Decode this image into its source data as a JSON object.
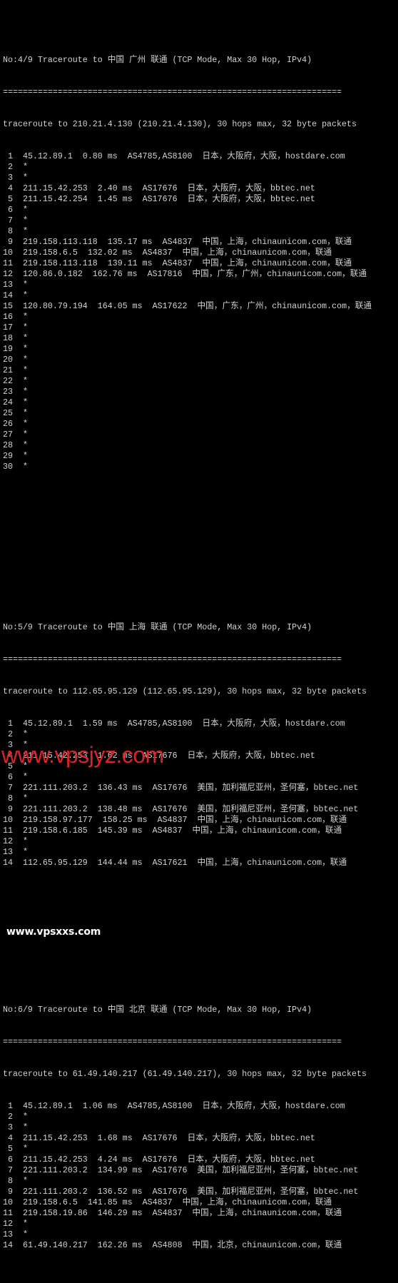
{
  "watermarks": {
    "top": "www.vpsxxs.com",
    "bottom": "www.vpsjyz.com",
    "bottom_color": "#e3262b"
  },
  "sections": [
    {
      "header": "No:4/9 Traceroute to 中国 广州 联通 (TCP Mode, Max 30 Hop, IPv4)",
      "separator": "====================================================================",
      "summary": "traceroute to 210.21.4.130 (210.21.4.130), 30 hops max, 32 byte packets",
      "hops": [
        {
          "n": "1",
          "ip": "45.12.89.1",
          "rtt": "0.80 ms",
          "asn": "AS4785,AS8100",
          "geo": "日本，大阪府，大阪，hostdare.com"
        },
        {
          "n": "2",
          "star": "*"
        },
        {
          "n": "3",
          "star": "*"
        },
        {
          "n": "4",
          "ip": "211.15.42.253",
          "rtt": "2.40 ms",
          "asn": "AS17676",
          "geo": "日本，大阪府，大阪，bbtec.net"
        },
        {
          "n": "5",
          "ip": "211.15.42.254",
          "rtt": "1.45 ms",
          "asn": "AS17676",
          "geo": "日本，大阪府，大阪，bbtec.net"
        },
        {
          "n": "6",
          "star": "*"
        },
        {
          "n": "7",
          "star": "*"
        },
        {
          "n": "8",
          "star": "*"
        },
        {
          "n": "9",
          "ip": "219.158.113.118",
          "rtt": "135.17 ms",
          "asn": "AS4837",
          "geo": "中国，上海，chinaunicom.com，联通"
        },
        {
          "n": "10",
          "ip": "219.158.6.5",
          "rtt": "132.02 ms",
          "asn": "AS4837",
          "geo": "中国，上海，chinaunicom.com，联通"
        },
        {
          "n": "11",
          "ip": "219.158.113.118",
          "rtt": "139.11 ms",
          "asn": "AS4837",
          "geo": "中国，上海，chinaunicom.com，联通"
        },
        {
          "n": "12",
          "ip": "120.86.0.182",
          "rtt": "162.76 ms",
          "asn": "AS17816",
          "geo": "中国，广东，广州，chinaunicom.com，联通"
        },
        {
          "n": "13",
          "star": "*"
        },
        {
          "n": "14",
          "star": "*"
        },
        {
          "n": "15",
          "ip": "120.80.79.194",
          "rtt": "164.05 ms",
          "asn": "AS17622",
          "geo": "中国，广东，广州，chinaunicom.com，联通"
        },
        {
          "n": "16",
          "star": "*"
        },
        {
          "n": "17",
          "star": "*"
        },
        {
          "n": "18",
          "star": "*"
        },
        {
          "n": "19",
          "star": "*"
        },
        {
          "n": "20",
          "star": "*"
        },
        {
          "n": "21",
          "star": "*"
        },
        {
          "n": "22",
          "star": "*"
        },
        {
          "n": "23",
          "star": "*"
        },
        {
          "n": "24",
          "star": "*"
        },
        {
          "n": "25",
          "star": "*"
        },
        {
          "n": "26",
          "star": "*"
        },
        {
          "n": "27",
          "star": "*"
        },
        {
          "n": "28",
          "star": "*"
        },
        {
          "n": "29",
          "star": "*"
        },
        {
          "n": "30",
          "star": "*"
        }
      ]
    },
    {
      "header": "No:5/9 Traceroute to 中国 上海 联通 (TCP Mode, Max 30 Hop, IPv4)",
      "separator": "====================================================================",
      "summary": "traceroute to 112.65.95.129 (112.65.95.129), 30 hops max, 32 byte packets",
      "hops": [
        {
          "n": "1",
          "ip": "45.12.89.1",
          "rtt": "1.59 ms",
          "asn": "AS4785,AS8100",
          "geo": "日本，大阪府，大阪，hostdare.com"
        },
        {
          "n": "2",
          "star": "*"
        },
        {
          "n": "3",
          "star": "*"
        },
        {
          "n": "4",
          "ip": "211.15.42.253",
          "rtt": "1.62 ms",
          "asn": "AS17676",
          "geo": "日本，大阪府，大阪，bbtec.net"
        },
        {
          "n": "5",
          "star": "*"
        },
        {
          "n": "6",
          "star": "*"
        },
        {
          "n": "7",
          "ip": "221.111.203.2",
          "rtt": "136.43 ms",
          "asn": "AS17676",
          "geo": "美国，加利福尼亚州，圣何塞，bbtec.net"
        },
        {
          "n": "8",
          "star": "*"
        },
        {
          "n": "9",
          "ip": "221.111.203.2",
          "rtt": "138.48 ms",
          "asn": "AS17676",
          "geo": "美国，加利福尼亚州，圣何塞，bbtec.net"
        },
        {
          "n": "10",
          "ip": "219.158.97.177",
          "rtt": "158.25 ms",
          "asn": "AS4837",
          "geo": "中国，上海，chinaunicom.com，联通"
        },
        {
          "n": "11",
          "ip": "219.158.6.185",
          "rtt": "145.39 ms",
          "asn": "AS4837",
          "geo": "中国，上海，chinaunicom.com，联通"
        },
        {
          "n": "12",
          "star": "*"
        },
        {
          "n": "13",
          "star": "*"
        },
        {
          "n": "14",
          "ip": "112.65.95.129",
          "rtt": "144.44 ms",
          "asn": "AS17621",
          "geo": "中国，上海，chinaunicom.com，联通"
        }
      ]
    },
    {
      "header": "No:6/9 Traceroute to 中国 北京 联通 (TCP Mode, Max 30 Hop, IPv4)",
      "separator": "====================================================================",
      "summary": "traceroute to 61.49.140.217 (61.49.140.217), 30 hops max, 32 byte packets",
      "hops": [
        {
          "n": "1",
          "ip": "45.12.89.1",
          "rtt": "1.06 ms",
          "asn": "AS4785,AS8100",
          "geo": "日本，大阪府，大阪，hostdare.com"
        },
        {
          "n": "2",
          "star": "*"
        },
        {
          "n": "3",
          "star": "*"
        },
        {
          "n": "4",
          "ip": "211.15.42.253",
          "rtt": "1.68 ms",
          "asn": "AS17676",
          "geo": "日本，大阪府，大阪，bbtec.net"
        },
        {
          "n": "5",
          "star": "*"
        },
        {
          "n": "6",
          "ip": "211.15.42.253",
          "rtt": "4.24 ms",
          "asn": "AS17676",
          "geo": "日本，大阪府，大阪，bbtec.net"
        },
        {
          "n": "7",
          "ip": "221.111.203.2",
          "rtt": "134.99 ms",
          "asn": "AS17676",
          "geo": "美国，加利福尼亚州，圣何塞，bbtec.net"
        },
        {
          "n": "8",
          "star": "*"
        },
        {
          "n": "9",
          "ip": "221.111.203.2",
          "rtt": "136.52 ms",
          "asn": "AS17676",
          "geo": "美国，加利福尼亚州，圣何塞，bbtec.net"
        },
        {
          "n": "10",
          "ip": "219.158.6.5",
          "rtt": "141.85 ms",
          "asn": "AS4837",
          "geo": "中国，上海，chinaunicom.com，联通"
        },
        {
          "n": "11",
          "ip": "219.158.19.86",
          "rtt": "146.29 ms",
          "asn": "AS4837",
          "geo": "中国，上海，chinaunicom.com，联通"
        },
        {
          "n": "12",
          "star": "*"
        },
        {
          "n": "13",
          "star": "*"
        },
        {
          "n": "14",
          "ip": "61.49.140.217",
          "rtt": "162.26 ms",
          "asn": "AS4808",
          "geo": "中国，北京，chinaunicom.com，联通"
        }
      ]
    }
  ]
}
